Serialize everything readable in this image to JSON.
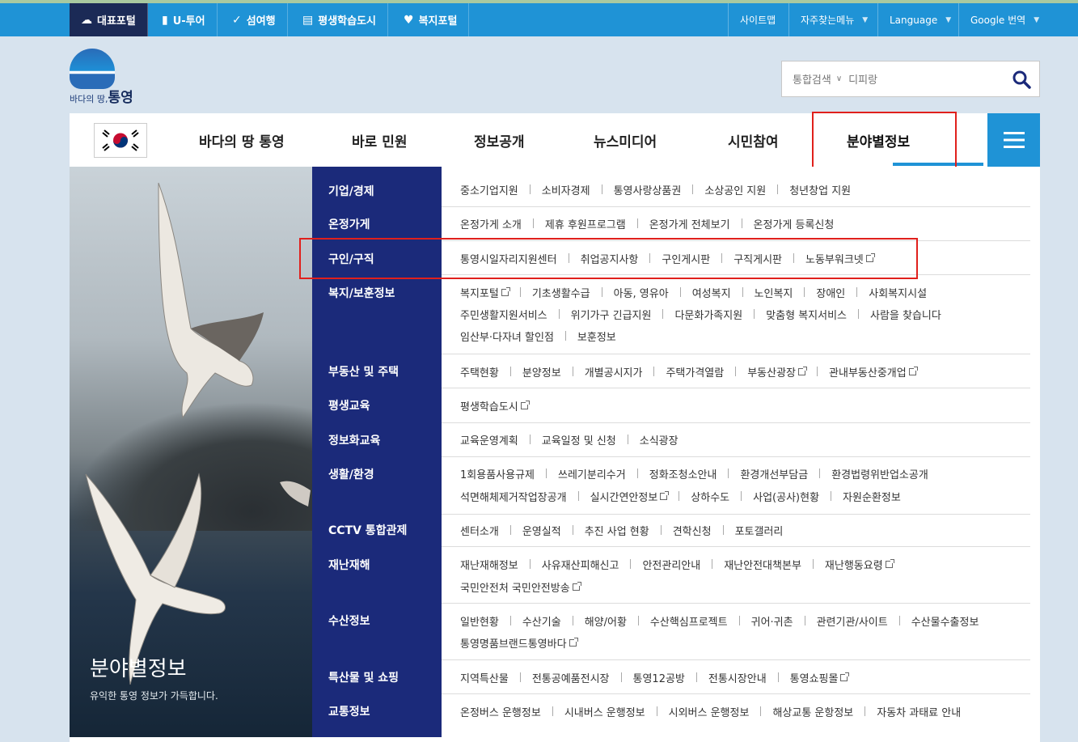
{
  "topbar": {
    "left_items": [
      {
        "label": "대표포털",
        "icon": "portal-icon"
      },
      {
        "label": "U-투어",
        "icon": "u-tour-icon"
      },
      {
        "label": "섬여행",
        "icon": "island-travel-icon"
      },
      {
        "label": "평생학습도시",
        "icon": "book-icon"
      },
      {
        "label": "복지포털",
        "icon": "heart-icon"
      }
    ],
    "right_items": [
      {
        "label": "사이트맵"
      },
      {
        "label": "자주찾는메뉴"
      },
      {
        "label": "Language"
      },
      {
        "label": "Google 번역"
      }
    ],
    "colors": {
      "bar": "#1f93d6",
      "active": "#1b2a56"
    }
  },
  "logo": {
    "sub": "바다의 땅,",
    "name": "통영"
  },
  "search": {
    "scope": "통합검색",
    "placeholder": "디피랑"
  },
  "nav": {
    "items": [
      "바다의 땅 통영",
      "바로 민원",
      "정보공개",
      "뉴스미디어",
      "시민참여",
      "분야별정보"
    ],
    "active": "분야별정보"
  },
  "hero": {
    "title": "분야별정보",
    "subtitle": "유익한 통영 정보가 가득합니다."
  },
  "categories": [
    {
      "name": "기업/경제",
      "lines": [
        [
          "중소기업지원",
          "소비자경제",
          "통영사랑상품권",
          "소상공인 지원",
          "청년창업 지원"
        ]
      ]
    },
    {
      "name": "온정가게",
      "lines": [
        [
          "온정가게 소개",
          "제휴 후원프로그램",
          "온정가게 전체보기",
          "온정가게 등록신청"
        ]
      ]
    },
    {
      "name": "구인/구직",
      "lines": [
        [
          "통영시일자리지원센터",
          "취업공지사항",
          "구인게시판",
          "구직게시판",
          "노동부워크넷"
        ]
      ]
    },
    {
      "name": "복지/보훈정보",
      "lines": [
        [
          "복지포털",
          "기초생활수급",
          "아동, 영유아",
          "여성복지",
          "노인복지",
          "장애인",
          "사회복지시설"
        ],
        [
          "주민생활지원서비스",
          "위기가구 긴급지원",
          "다문화가족지원",
          "맞춤형 복지서비스",
          "사람을 찾습니다"
        ],
        [
          "임산부·다자녀 할인점",
          "보훈정보"
        ]
      ]
    },
    {
      "name": "부동산 및 주택",
      "lines": [
        [
          "주택현황",
          "분양정보",
          "개별공시지가",
          "주택가격열람",
          "부동산광장",
          "관내부동산중개업"
        ]
      ]
    },
    {
      "name": "평생교육",
      "lines": [
        [
          "평생학습도시"
        ]
      ]
    },
    {
      "name": "정보화교육",
      "lines": [
        [
          "교육운영계획",
          "교육일정 및 신청",
          "소식광장"
        ]
      ]
    },
    {
      "name": "생활/환경",
      "lines": [
        [
          "1회용품사용규제",
          "쓰레기분리수거",
          "정화조청소안내",
          "환경개선부담금",
          "환경법령위반업소공개"
        ],
        [
          "석면해체제거작업장공개",
          "실시간연안정보",
          "상하수도",
          "사업(공사)현황",
          "자원순환정보"
        ]
      ]
    },
    {
      "name": "CCTV 통합관제",
      "lines": [
        [
          "센터소개",
          "운영실적",
          "추진 사업 현황",
          "견학신청",
          "포토갤러리"
        ]
      ]
    },
    {
      "name": "재난재해",
      "lines": [
        [
          "재난재해정보",
          "사유재산피해신고",
          "안전관리안내",
          "재난안전대책본부",
          "재난행동요령"
        ],
        [
          "국민안전처 국민안전방송"
        ]
      ]
    },
    {
      "name": "수산정보",
      "lines": [
        [
          "일반현황",
          "수산기술",
          "해양/어황",
          "수산핵심프로젝트",
          "귀어·귀촌",
          "관련기관/사이트",
          "수산물수출정보"
        ],
        [
          "통영명품브랜드통영바다"
        ]
      ]
    },
    {
      "name": "특산물 및 쇼핑",
      "lines": [
        [
          "지역특산물",
          "전통공예품전시장",
          "통영12공방",
          "전통시장안내",
          "통영쇼핑몰"
        ]
      ]
    },
    {
      "name": "교통정보",
      "lines": [
        [
          "온정버스 운행정보",
          "시내버스 운행정보",
          "시외버스 운행정보",
          "해상교통 운항정보",
          "자동차 과태료 안내"
        ]
      ]
    }
  ]
}
